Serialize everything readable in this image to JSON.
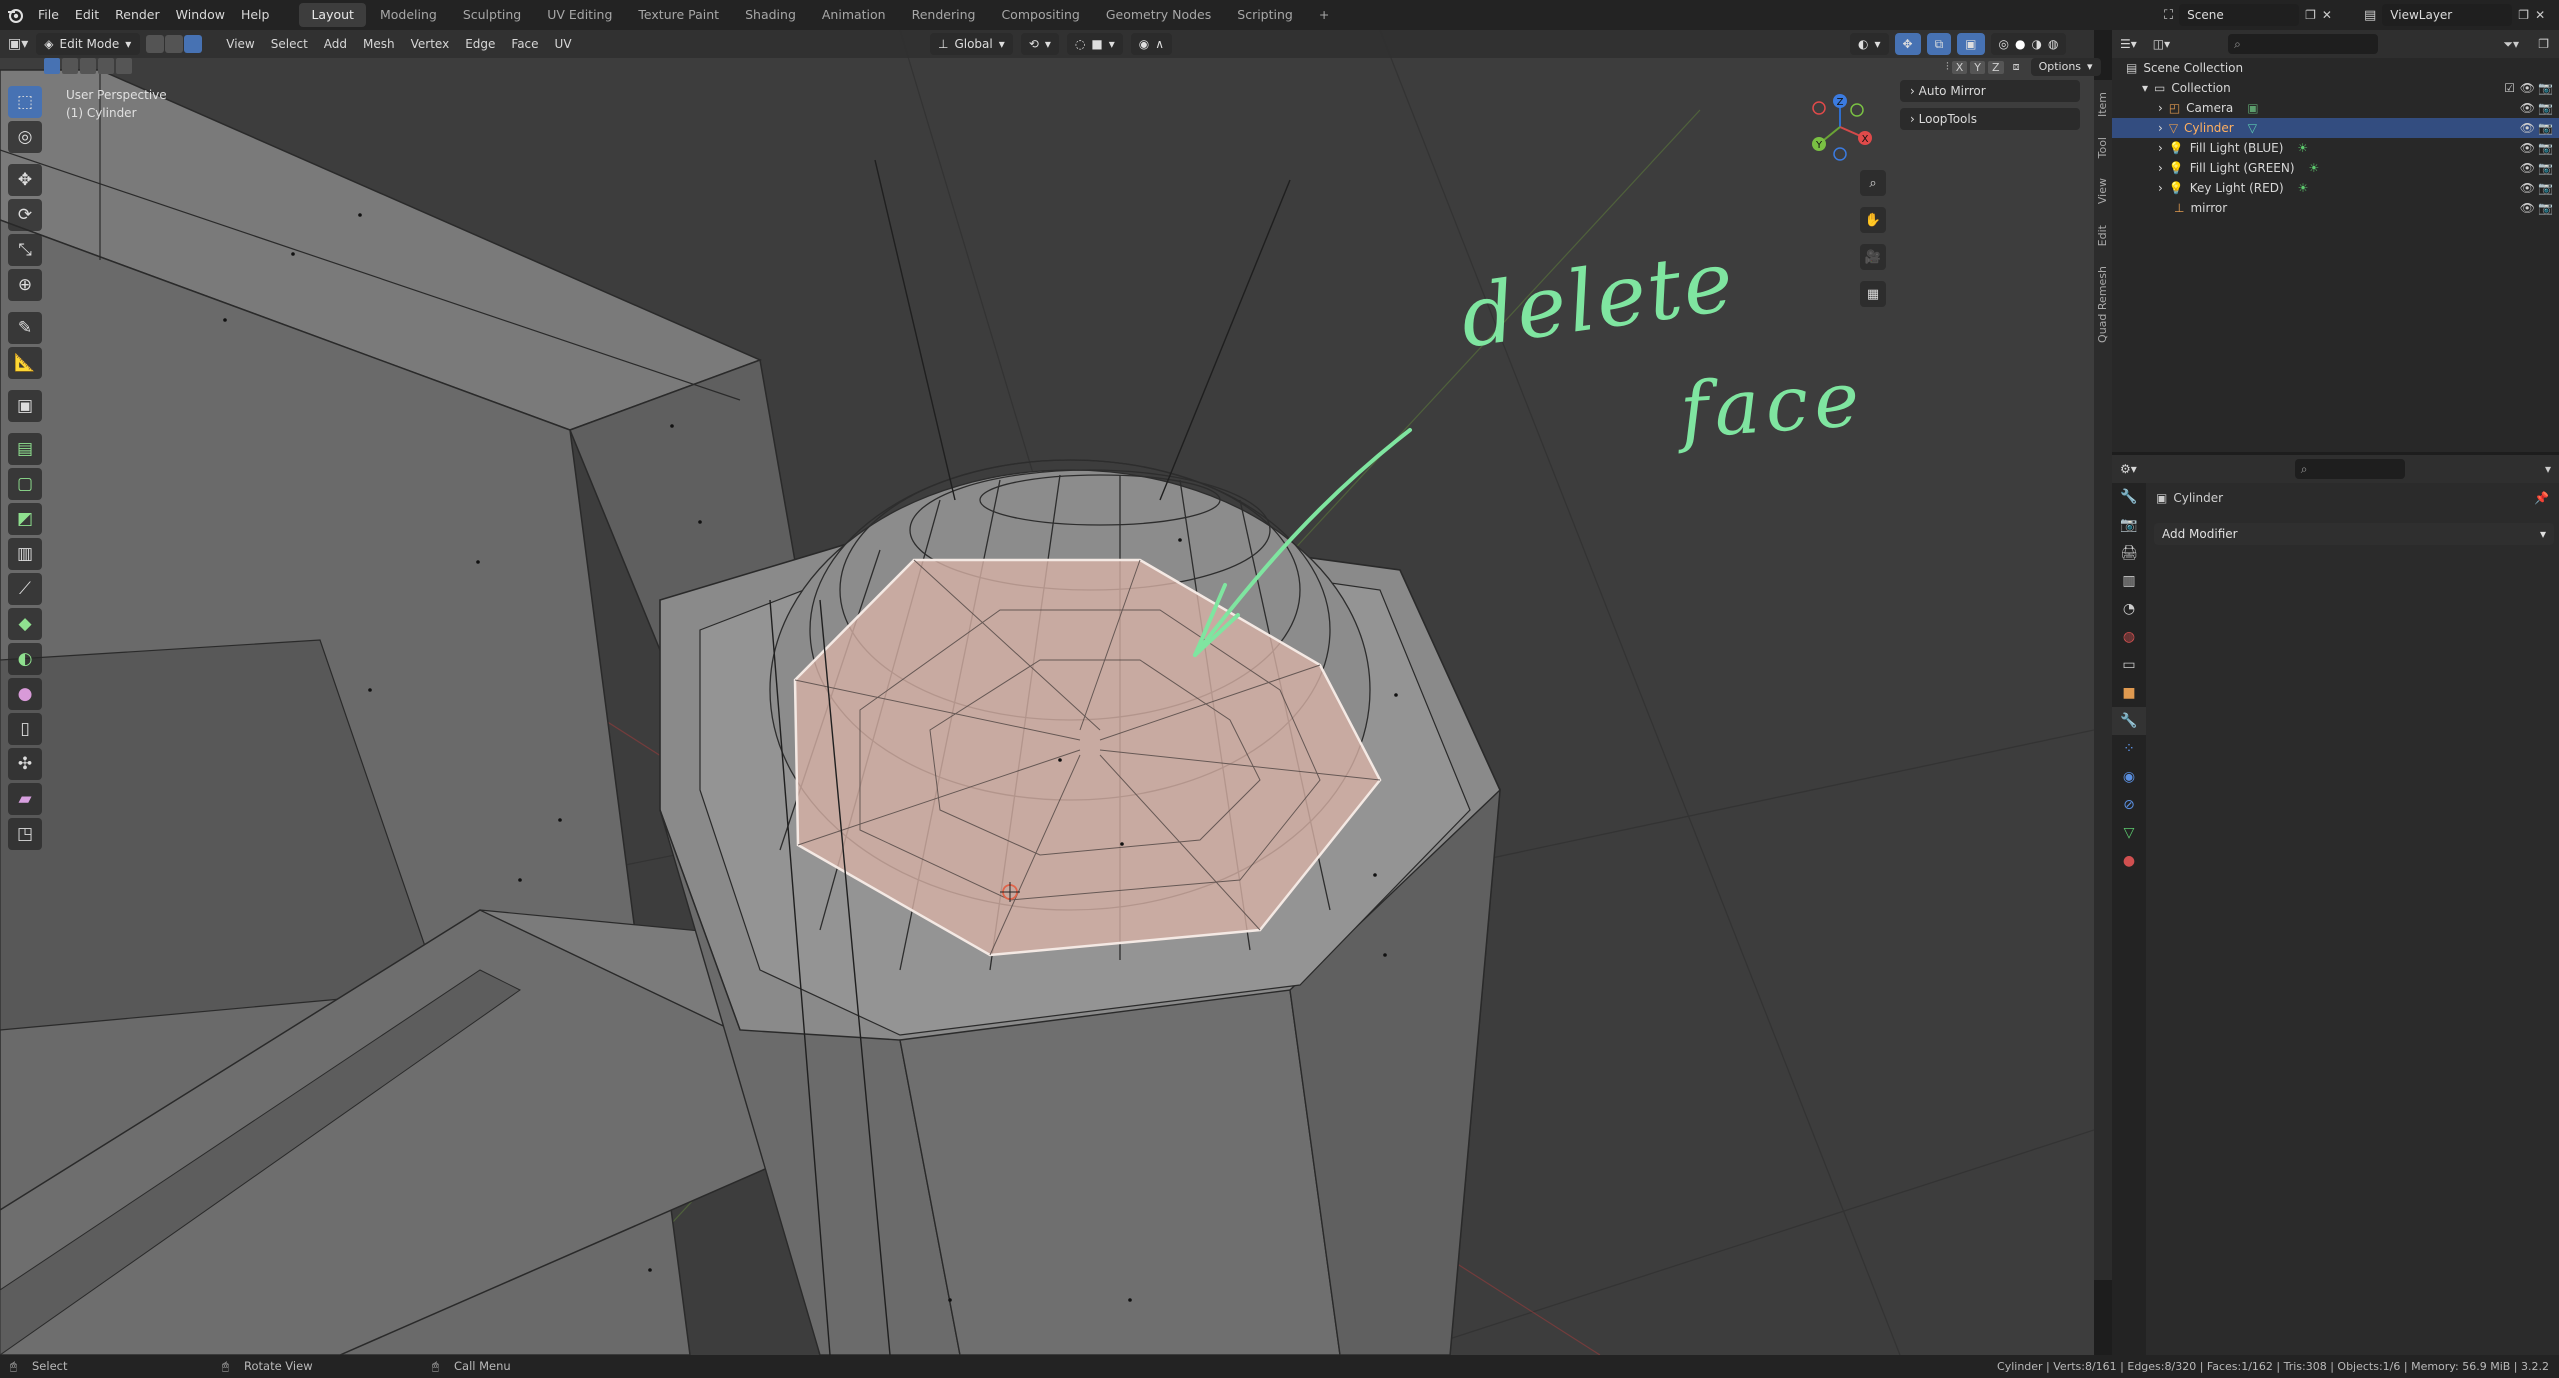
{
  "menubar": {
    "items": [
      "File",
      "Edit",
      "Render",
      "Window",
      "Help"
    ],
    "workspaces": [
      "Layout",
      "Modeling",
      "Sculpting",
      "UV Editing",
      "Texture Paint",
      "Shading",
      "Animation",
      "Rendering",
      "Compositing",
      "Geometry Nodes",
      "Scripting"
    ],
    "active_workspace": "Layout",
    "add_tab": "+",
    "scene": "Scene",
    "view_layer": "ViewLayer"
  },
  "viewport_header": {
    "mode": "Edit Mode",
    "menus": [
      "View",
      "Select",
      "Add",
      "Mesh",
      "Vertex",
      "Edge",
      "Face",
      "UV"
    ],
    "orientation": "Global",
    "xyz": [
      "X",
      "Y",
      "Z"
    ],
    "options": "Options"
  },
  "viewport": {
    "perspective": "User Perspective",
    "object": "(1) Cylinder",
    "panels": [
      "Auto Mirror",
      "LoopTools"
    ],
    "annotation_line1": "delete",
    "annotation_line2": "face",
    "annotation_color": "#7fe5a0",
    "gizmo": {
      "x": "X",
      "y": "Y",
      "z": "Z"
    }
  },
  "side_tabs": [
    "Item",
    "Tool",
    "View",
    "Edit",
    "Quad Remesh"
  ],
  "outliner": {
    "root": "Scene Collection",
    "collection": "Collection",
    "items": [
      {
        "name": "Camera",
        "type": "camera",
        "selected": false
      },
      {
        "name": "Cylinder",
        "type": "mesh",
        "selected": true
      },
      {
        "name": "Fill Light (BLUE)",
        "type": "light",
        "selected": false
      },
      {
        "name": "Fill Light (GREEN)",
        "type": "light",
        "selected": false
      },
      {
        "name": "Key Light (RED)",
        "type": "light",
        "selected": false
      },
      {
        "name": "mirror",
        "type": "empty",
        "selected": false
      }
    ]
  },
  "properties": {
    "object_name": "Cylinder",
    "add_modifier": "Add Modifier"
  },
  "statusbar": {
    "select": "Select",
    "rotate": "Rotate View",
    "call_menu": "Call Menu",
    "stats": "Cylinder | Verts:8/161 | Edges:8/320 | Faces:1/162 | Tris:308 | Objects:1/6 | Memory: 56.9 MiB | 3.2.2"
  },
  "colors": {
    "accent": "#4772b3",
    "selected_face": "#e8b8a8",
    "annotation": "#7fe5a0"
  }
}
